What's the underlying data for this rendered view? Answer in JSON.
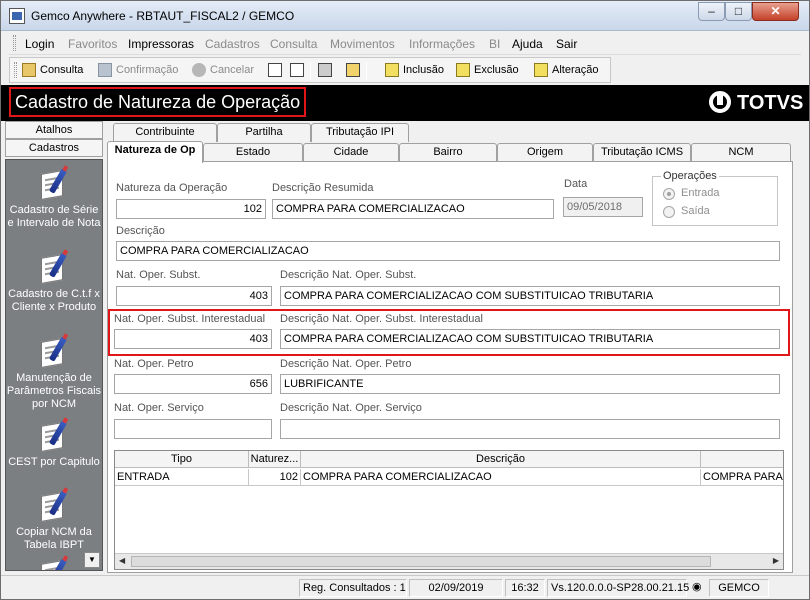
{
  "window": {
    "title": "Gemco Anywhere - RBTAUT_FISCAL2 / GEMCO",
    "min": "–",
    "max": "□",
    "close": "✕"
  },
  "menu": [
    {
      "label": "Login",
      "enabled": true
    },
    {
      "label": "Favoritos",
      "enabled": false
    },
    {
      "label": "Impressoras",
      "enabled": true
    },
    {
      "label": "Cadastros",
      "enabled": false
    },
    {
      "label": "Consulta",
      "enabled": false
    },
    {
      "label": "Movimentos",
      "enabled": false
    },
    {
      "label": "Informações",
      "enabled": false
    },
    {
      "label": "BI",
      "enabled": false
    },
    {
      "label": "Ajuda",
      "enabled": true
    },
    {
      "label": "Sair",
      "enabled": true
    }
  ],
  "toolbar": {
    "consulta": "Consulta",
    "confirmacao": "Confirmação",
    "cancelar": "Cancelar",
    "inclusao": "Inclusão",
    "exclusao": "Exclusão",
    "alteracao": "Alteração"
  },
  "header": {
    "title": "Cadastro de Natureza de Operação",
    "logo": "TOTVS"
  },
  "sidebar": {
    "tabs": [
      "Atalhos",
      "Cadastros"
    ],
    "items": [
      "Cadastro de Série e Intervalo de Nota",
      "Cadastro de C.t.f x Cliente x Produto",
      "Manutenção de Parâmetros Fiscais por NCM",
      "CEST por Capitulo",
      "Copiar NCM da Tabela IBPT"
    ],
    "scroll_down": "▼"
  },
  "tabs_row1": [
    "Contribuinte",
    "Partilha",
    "Tributação IPI"
  ],
  "tabs_row2": [
    "Natureza de Op",
    "Estado",
    "Cidade",
    "Bairro",
    "Origem",
    "Tributação ICMS",
    "NCM"
  ],
  "form": {
    "natureza_label": "Natureza da Operação",
    "natureza_value": "102",
    "descricao_resumida_label": "Descrição Resumida",
    "descricao_resumida_value": "COMPRA PARA COMERCIALIZACAO",
    "data_label": "Data",
    "data_value": "09/05/2018",
    "operacoes_label": "Operações",
    "entrada_label": "Entrada",
    "saida_label": "Saída",
    "operacao_selected": "Entrada",
    "descricao_label": "Descrição",
    "descricao_value": "COMPRA PARA COMERCIALIZACAO",
    "subst_label": "Nat. Oper. Subst.",
    "subst_value": "403",
    "subst_desc_label": "Descrição Nat. Oper. Subst.",
    "subst_desc_value": "COMPRA PARA COMERCIALIZACAO COM SUBSTITUICAO TRIBUTARIA",
    "subst_inter_label": "Nat. Oper. Subst. Interestadual",
    "subst_inter_value": "403",
    "subst_inter_desc_label": "Descrição Nat. Oper. Subst. Interestadual",
    "subst_inter_desc_value": "COMPRA PARA COMERCIALIZACAO COM SUBSTITUICAO TRIBUTARIA",
    "petro_label": "Nat. Oper. Petro",
    "petro_value": "656",
    "petro_desc_label": "Descrição Nat. Oper. Petro",
    "petro_desc_value": "LUBRIFICANTE",
    "servico_label": "Nat. Oper. Serviço",
    "servico_value": "",
    "servico_desc_label": "Descrição Nat. Oper. Serviço",
    "servico_desc_value": ""
  },
  "grid": {
    "columns": [
      "Tipo",
      "Naturez...",
      "Descrição",
      ""
    ],
    "rows": [
      [
        "ENTRADA",
        "102",
        "COMPRA PARA COMERCIALIZACAO",
        "COMPRA PARA"
      ]
    ]
  },
  "status": {
    "registros": "Reg. Consultados : 1",
    "date": "02/09/2019",
    "time": "16:32",
    "version": "Vs.120.0.0.0-SP28.00.21.15",
    "company": "GEMCO"
  },
  "colors": {
    "accent_red": "#e0161b",
    "header_bg": "#000000",
    "sidebar_bg": "#7b7f82"
  }
}
